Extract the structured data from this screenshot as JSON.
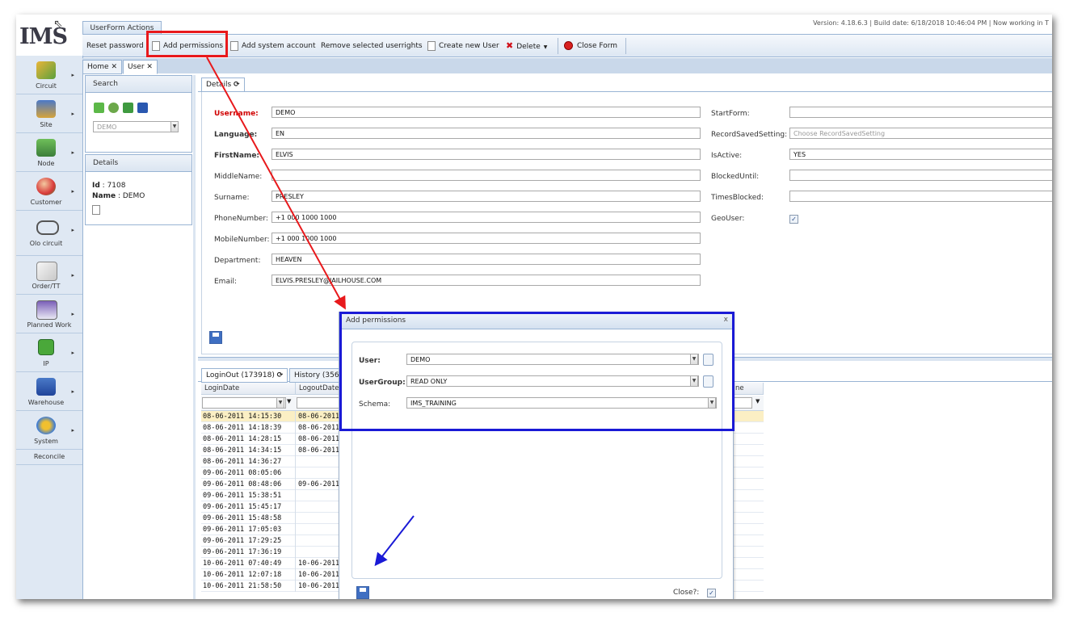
{
  "app": {
    "logo": "IMS",
    "version": "Version: 4.18.6.3 | Build date: 6/18/2018 10:46:04 PM | Now working in T"
  },
  "ribbon": {
    "tab": "UserForm Actions",
    "reset_password": "Reset password",
    "add_permissions": "Add permissions",
    "add_system_account": "Add system account",
    "remove_userrights": "Remove selected userrights",
    "create_new_user": "Create new User",
    "delete": "Delete",
    "close_form": "Close Form"
  },
  "sidebar": {
    "items": [
      {
        "label": "Circuit",
        "icon": "circuit-icon"
      },
      {
        "label": "Site",
        "icon": "city-icon"
      },
      {
        "label": "Node",
        "icon": "node-icon"
      },
      {
        "label": "Customer",
        "icon": "customer-icon"
      },
      {
        "label": "Olo circuit",
        "icon": "glasses-icon"
      },
      {
        "label": "Order/TT",
        "icon": "order-icon"
      },
      {
        "label": "Planned Work",
        "icon": "calendar-icon"
      },
      {
        "label": "IP",
        "icon": "ip-icon"
      },
      {
        "label": "Warehouse",
        "icon": "warehouse-icon"
      },
      {
        "label": "System",
        "icon": "gears-icon"
      }
    ],
    "reconcile": "Reconcile"
  },
  "tabs": {
    "home": "Home",
    "user": "User",
    "close": "✕"
  },
  "search": {
    "title": "Search",
    "select_value": "DEMO"
  },
  "details_panel": {
    "title": "Details",
    "id_label": "Id",
    "id_value": "7108",
    "name_label": "Name",
    "name_value": "DEMO"
  },
  "form": {
    "tab": "Details",
    "fields": {
      "username": {
        "label": "Username:",
        "value": "DEMO"
      },
      "language": {
        "label": "Language:",
        "value": "EN"
      },
      "firstname": {
        "label": "FirstName:",
        "value": "ELVIS"
      },
      "middlename": {
        "label": "MiddleName:",
        "value": ""
      },
      "surname": {
        "label": "Surname:",
        "value": "PRESLEY"
      },
      "phone": {
        "label": "PhoneNumber:",
        "value": "+1 000 1000 1000"
      },
      "mobile": {
        "label": "MobileNumber:",
        "value": "+1 000 1000 1000"
      },
      "department": {
        "label": "Department:",
        "value": "HEAVEN"
      },
      "email": {
        "label": "Email:",
        "value": "ELVIS.PRESLEY@JAILHOUSE.COM"
      },
      "startform": {
        "label": "StartForm:",
        "value": ""
      },
      "recordsaved": {
        "label": "RecordSavedSetting:",
        "placeholder": "Choose RecordSavedSetting"
      },
      "isactive": {
        "label": "IsActive:",
        "value": "YES"
      },
      "blockeduntil": {
        "label": "BlockedUntil:",
        "value": ""
      },
      "timesblocked": {
        "label": "TimesBlocked:",
        "value": ""
      },
      "geouser": {
        "label": "GeoUser:",
        "value": "✓"
      }
    }
  },
  "grid": {
    "tab_loginout": "LoginOut (173918)",
    "tab_history": "History (356",
    "col_login": "LoginDate",
    "col_logout": "LogoutDate",
    "col_ne": "ne",
    "rows": [
      {
        "login": "08-06-2011 14:15:30",
        "logout": "08-06-2011"
      },
      {
        "login": "08-06-2011 14:18:39",
        "logout": "08-06-2011"
      },
      {
        "login": "08-06-2011 14:28:15",
        "logout": "08-06-2011"
      },
      {
        "login": "08-06-2011 14:34:15",
        "logout": "08-06-2011"
      },
      {
        "login": "08-06-2011 14:36:27",
        "logout": ""
      },
      {
        "login": "09-06-2011 08:05:06",
        "logout": ""
      },
      {
        "login": "09-06-2011 08:48:06",
        "logout": "09-06-2011"
      },
      {
        "login": "09-06-2011 15:38:51",
        "logout": ""
      },
      {
        "login": "09-06-2011 15:45:17",
        "logout": ""
      },
      {
        "login": "09-06-2011 15:48:58",
        "logout": ""
      },
      {
        "login": "09-06-2011 17:05:03",
        "logout": ""
      },
      {
        "login": "09-06-2011 17:29:25",
        "logout": ""
      },
      {
        "login": "09-06-2011 17:36:19",
        "logout": ""
      },
      {
        "login": "10-06-2011 07:40:49",
        "logout": "10-06-2011"
      },
      {
        "login": "10-06-2011 12:07:18",
        "logout": "10-06-2011"
      },
      {
        "login": "10-06-2011 21:58:50",
        "logout": "10-06-2011"
      }
    ]
  },
  "dialog": {
    "title": "Add permissions",
    "close": "x",
    "user_label": "User:",
    "user_value": "DEMO",
    "usergroup_label": "UserGroup:",
    "usergroup_value": "READ ONLY",
    "schema_label": "Schema:",
    "schema_value": "IMS_TRAINING",
    "close_q_label": "Close?:",
    "close_q_value": "✓"
  },
  "colors": {
    "highlight_red": "#e8191c",
    "highlight_blue": "#1a1ad6",
    "arrow_red": "#e8191c",
    "arrow_blue": "#1a1ad6"
  }
}
